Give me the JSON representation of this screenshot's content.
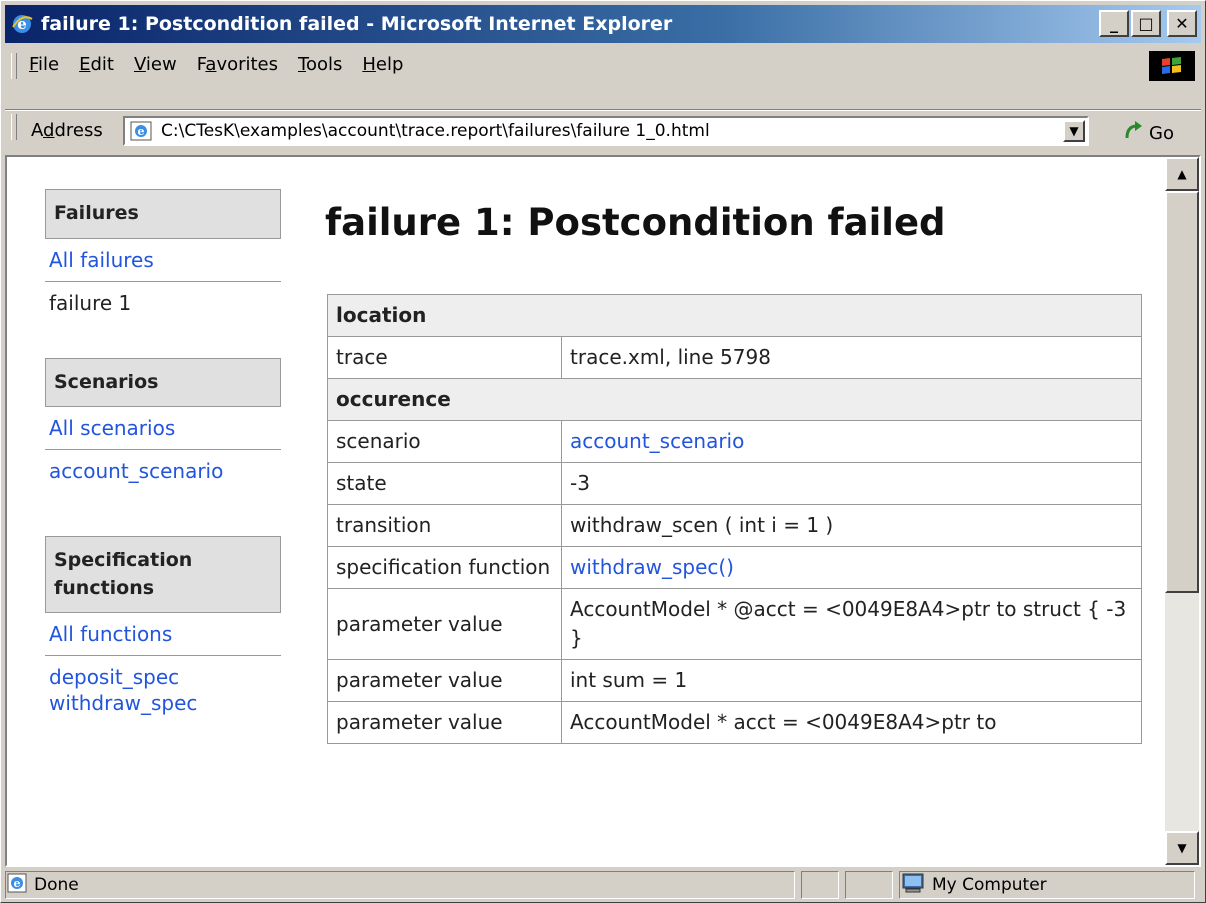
{
  "window": {
    "title": "failure 1: Postcondition failed - Microsoft Internet Explorer",
    "minimize_glyph": "_",
    "maximize_glyph": "□",
    "close_glyph": "✕"
  },
  "menu": {
    "items": [
      {
        "underline": "F",
        "rest": "ile"
      },
      {
        "underline": "E",
        "rest": "dit"
      },
      {
        "underline": "V",
        "rest": "iew"
      },
      {
        "pre": "F",
        "underline": "a",
        "rest": "vorites"
      },
      {
        "underline": "T",
        "rest": "ools"
      },
      {
        "underline": "H",
        "rest": "elp"
      }
    ]
  },
  "address": {
    "label_pre": "A",
    "label_u": "d",
    "label_rest": "dress",
    "url": "C:\\CTesK\\examples\\account\\trace.report\\failures\\failure 1_0.html",
    "go_label": "Go"
  },
  "sidebar": {
    "failures_heading": "Failures",
    "all_failures": "All failures",
    "current_failure": "failure 1",
    "scenarios_heading": "Scenarios",
    "all_scenarios": "All scenarios",
    "scenario_link": "account_scenario",
    "functions_heading": "Specification functions",
    "all_functions": "All functions",
    "function_links": [
      "deposit_spec",
      "withdraw_spec"
    ]
  },
  "main": {
    "title": "failure 1: Postcondition failed",
    "table": {
      "location_header": "location",
      "trace_key": "trace",
      "trace_value": "trace.xml, line 5798",
      "occurence_header": "occurence",
      "scenario_key": "scenario",
      "scenario_value": "account_scenario",
      "state_key": "state",
      "state_value": "-3",
      "transition_key": "transition",
      "transition_value": "withdraw_scen ( int i = 1 )",
      "specfn_key": "specification function",
      "specfn_value": "withdraw_spec()",
      "param1_key": "parameter value",
      "param1_value": "AccountModel * @acct = <0049E8A4>ptr to struct { -3 }",
      "param2_key": "parameter value",
      "param2_value": "int sum = 1",
      "param3_key": "parameter value",
      "param3_value": "AccountModel * acct = <0049E8A4>ptr to"
    }
  },
  "status": {
    "text": "Done",
    "zone": "My Computer"
  }
}
